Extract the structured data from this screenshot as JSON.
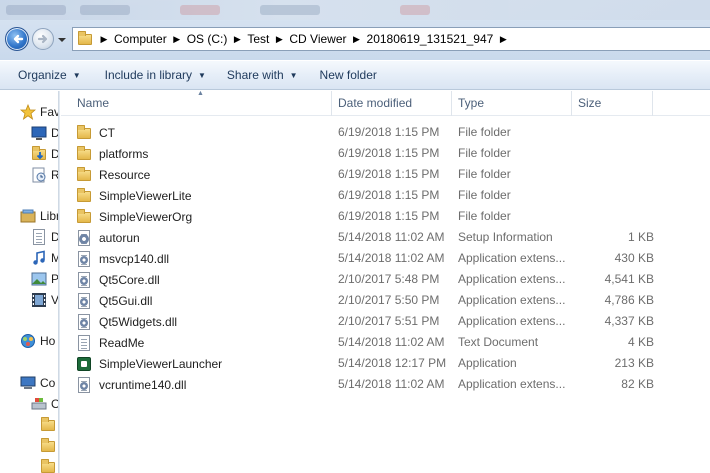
{
  "address": {
    "crumbs": [
      "Computer",
      "OS (C:)",
      "Test",
      "CD Viewer",
      "20180619_131521_947"
    ]
  },
  "toolbar": {
    "organize": "Organize",
    "include_in_library": "Include in library",
    "share_with": "Share with",
    "new_folder": "New folder"
  },
  "nav": {
    "favorites": "Fav",
    "fav_desktop": "D",
    "fav_downloads": "D",
    "fav_recent": "R",
    "libraries": "Libr",
    "lib_documents": "D",
    "lib_music": "M",
    "lib_pictures": "P",
    "lib_videos": "V",
    "homegroup": "Ho",
    "computer": "Co",
    "comp_drive": "O"
  },
  "columns": {
    "name": "Name",
    "date": "Date modified",
    "type": "Type",
    "size": "Size"
  },
  "files": [
    {
      "name": "CT",
      "date": "6/19/2018 1:15 PM",
      "type": "File folder",
      "size": "",
      "icon": "folder-icon"
    },
    {
      "name": "platforms",
      "date": "6/19/2018 1:15 PM",
      "type": "File folder",
      "size": "",
      "icon": "folder-icon"
    },
    {
      "name": "Resource",
      "date": "6/19/2018 1:15 PM",
      "type": "File folder",
      "size": "",
      "icon": "folder-icon"
    },
    {
      "name": "SimpleViewerLite",
      "date": "6/19/2018 1:15 PM",
      "type": "File folder",
      "size": "",
      "icon": "folder-icon"
    },
    {
      "name": "SimpleViewerOrg",
      "date": "6/19/2018 1:15 PM",
      "type": "File folder",
      "size": "",
      "icon": "folder-icon"
    },
    {
      "name": "autorun",
      "date": "5/14/2018 11:02 AM",
      "type": "Setup Information",
      "size": "1 KB",
      "icon": "setup-info-icon"
    },
    {
      "name": "msvcp140.dll",
      "date": "5/14/2018 11:02 AM",
      "type": "Application extens...",
      "size": "430 KB",
      "icon": "dll-icon"
    },
    {
      "name": "Qt5Core.dll",
      "date": "2/10/2017 5:48 PM",
      "type": "Application extens...",
      "size": "4,541 KB",
      "icon": "dll-icon"
    },
    {
      "name": "Qt5Gui.dll",
      "date": "2/10/2017 5:50 PM",
      "type": "Application extens...",
      "size": "4,786 KB",
      "icon": "dll-icon"
    },
    {
      "name": "Qt5Widgets.dll",
      "date": "2/10/2017 5:51 PM",
      "type": "Application extens...",
      "size": "4,337 KB",
      "icon": "dll-icon"
    },
    {
      "name": "ReadMe",
      "date": "5/14/2018 11:02 AM",
      "type": "Text Document",
      "size": "4 KB",
      "icon": "text-document-icon"
    },
    {
      "name": "SimpleViewerLauncher",
      "date": "5/14/2018 12:17 PM",
      "type": "Application",
      "size": "213 KB",
      "icon": "application-icon"
    },
    {
      "name": "vcruntime140.dll",
      "date": "5/14/2018 11:02 AM",
      "type": "Application extens...",
      "size": "82 KB",
      "icon": "dll-icon"
    }
  ]
}
